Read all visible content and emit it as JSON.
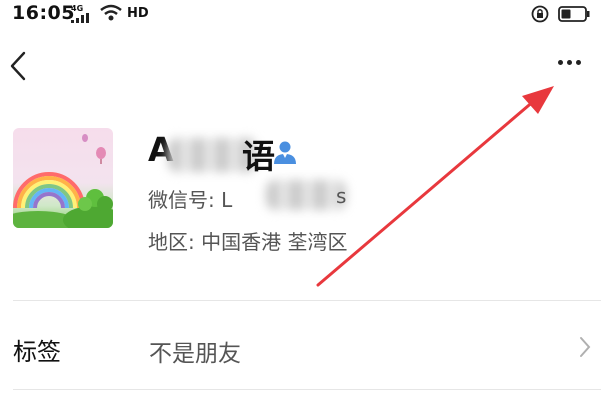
{
  "status_bar": {
    "time": "16:05",
    "network_label": "4G",
    "hd_label": "HD"
  },
  "nav": {
    "back_icon": "chevron-left-icon",
    "more_icon": "more-horizontal-icon"
  },
  "profile": {
    "name_visible": "A",
    "name_visible_end": "语",
    "wechat_id_label": "微信号: L",
    "wechat_id_end": "s",
    "region_label": "地区: 中国香港  荃湾区",
    "verify_icon": "person-badge-icon"
  },
  "tag_row": {
    "label": "标签",
    "value": "不是朋友",
    "chevron_icon": "chevron-right-icon"
  },
  "colors": {
    "annotation_arrow": "#e8383d",
    "verify_icon": "#4a8fe0"
  }
}
